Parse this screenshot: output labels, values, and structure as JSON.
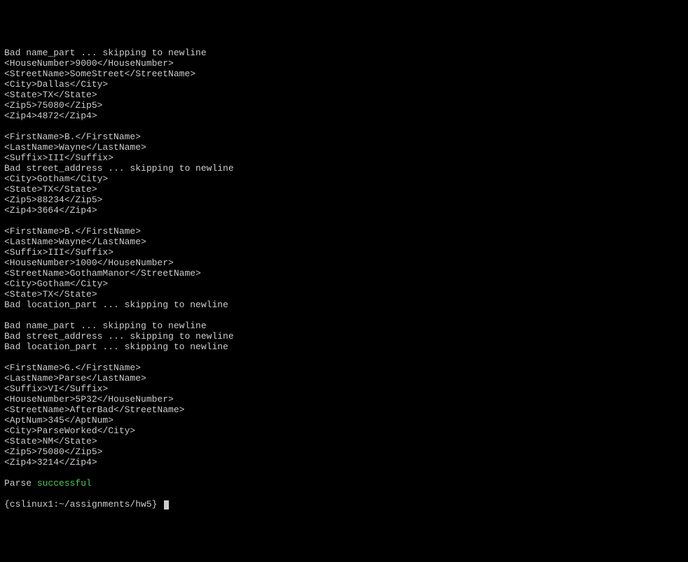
{
  "lines": [
    "Bad name_part ... skipping to newline",
    "<HouseNumber>9000</HouseNumber>",
    "<StreetName>SomeStreet</StreetName>",
    "<City>Dallas</City>",
    "<State>TX</State>",
    "<Zip5>75080</Zip5>",
    "<Zip4>4872</Zip4>",
    "",
    "<FirstName>B.</FirstName>",
    "<LastName>Wayne</LastName>",
    "<Suffix>III</Suffix>",
    "Bad street_address ... skipping to newline",
    "<City>Gotham</City>",
    "<State>TX</State>",
    "<Zip5>88234</Zip5>",
    "<Zip4>3664</Zip4>",
    "",
    "<FirstName>B.</FirstName>",
    "<LastName>Wayne</LastName>",
    "<Suffix>III</Suffix>",
    "<HouseNumber>1000</HouseNumber>",
    "<StreetName>GothamManor</StreetName>",
    "<City>Gotham</City>",
    "<State>TX</State>",
    "Bad location_part ... skipping to newline",
    "",
    "Bad name_part ... skipping to newline",
    "Bad street_address ... skipping to newline",
    "Bad location_part ... skipping to newline",
    "",
    "<FirstName>G.</FirstName>",
    "<LastName>Parse</LastName>",
    "<Suffix>VI</Suffix>",
    "<HouseNumber>5P32</HouseNumber>",
    "<StreetName>AfterBad</StreetName>",
    "<AptNum>345</AptNum>",
    "<City>ParseWorked</City>",
    "<State>NM</State>",
    "<Zip5>75080</Zip5>",
    "<Zip4>3214</Zip4>",
    ""
  ],
  "parse_prefix": "Parse ",
  "parse_status": "successful",
  "prompt": "{cslinux1:~/assignments/hw5} "
}
